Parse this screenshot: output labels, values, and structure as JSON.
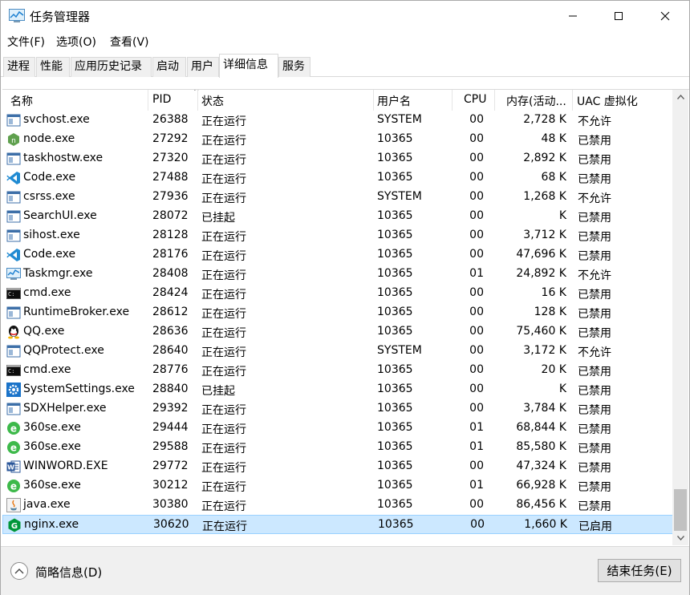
{
  "window": {
    "title": "任务管理器",
    "icon": "task-manager-icon"
  },
  "menu": [
    "文件(F)",
    "选项(O)",
    "查看(V)"
  ],
  "tabs": [
    "进程",
    "性能",
    "应用历史记录",
    "启动",
    "用户",
    "详细信息",
    "服务"
  ],
  "active_tab": "详细信息",
  "columns": {
    "name": "名称",
    "pid": "PID",
    "status": "状态",
    "user": "用户名",
    "cpu": "CPU",
    "mem": "内存(活动...",
    "uac": "UAC 虚拟化"
  },
  "rows": [
    {
      "icon": "svchost-icon",
      "name": "svchost.exe",
      "pid": "26388",
      "status": "正在运行",
      "user": "SYSTEM",
      "cpu": "00",
      "mem": "2,728 K",
      "uac": "不允许"
    },
    {
      "icon": "node-icon",
      "name": "node.exe",
      "pid": "27292",
      "status": "正在运行",
      "user": "10365",
      "cpu": "00",
      "mem": "48 K",
      "uac": "已禁用"
    },
    {
      "icon": "taskhostw-icon",
      "name": "taskhostw.exe",
      "pid": "27320",
      "status": "正在运行",
      "user": "10365",
      "cpu": "00",
      "mem": "2,892 K",
      "uac": "已禁用"
    },
    {
      "icon": "vscode-icon",
      "name": "Code.exe",
      "pid": "27488",
      "status": "正在运行",
      "user": "10365",
      "cpu": "00",
      "mem": "68 K",
      "uac": "已禁用"
    },
    {
      "icon": "csrss-icon",
      "name": "csrss.exe",
      "pid": "27936",
      "status": "正在运行",
      "user": "SYSTEM",
      "cpu": "00",
      "mem": "1,268 K",
      "uac": "不允许"
    },
    {
      "icon": "searchui-icon",
      "name": "SearchUI.exe",
      "pid": "28072",
      "status": "已挂起",
      "user": "10365",
      "cpu": "00",
      "mem": "K",
      "uac": "已禁用"
    },
    {
      "icon": "sihost-icon",
      "name": "sihost.exe",
      "pid": "28128",
      "status": "正在运行",
      "user": "10365",
      "cpu": "00",
      "mem": "3,712 K",
      "uac": "已禁用"
    },
    {
      "icon": "vscode-icon",
      "name": "Code.exe",
      "pid": "28176",
      "status": "正在运行",
      "user": "10365",
      "cpu": "00",
      "mem": "47,696 K",
      "uac": "已禁用"
    },
    {
      "icon": "taskmgr-icon",
      "name": "Taskmgr.exe",
      "pid": "28408",
      "status": "正在运行",
      "user": "10365",
      "cpu": "01",
      "mem": "24,892 K",
      "uac": "不允许"
    },
    {
      "icon": "cmd-icon",
      "name": "cmd.exe",
      "pid": "28424",
      "status": "正在运行",
      "user": "10365",
      "cpu": "00",
      "mem": "16 K",
      "uac": "已禁用"
    },
    {
      "icon": "runtimebroker-icon",
      "name": "RuntimeBroker.exe",
      "pid": "28612",
      "status": "正在运行",
      "user": "10365",
      "cpu": "00",
      "mem": "128 K",
      "uac": "已禁用"
    },
    {
      "icon": "qq-icon",
      "name": "QQ.exe",
      "pid": "28636",
      "status": "正在运行",
      "user": "10365",
      "cpu": "00",
      "mem": "75,460 K",
      "uac": "已禁用"
    },
    {
      "icon": "qqprotect-icon",
      "name": "QQProtect.exe",
      "pid": "28640",
      "status": "正在运行",
      "user": "SYSTEM",
      "cpu": "00",
      "mem": "3,172 K",
      "uac": "不允许"
    },
    {
      "icon": "cmd-icon",
      "name": "cmd.exe",
      "pid": "28776",
      "status": "正在运行",
      "user": "10365",
      "cpu": "00",
      "mem": "20 K",
      "uac": "已禁用"
    },
    {
      "icon": "settings-gear-icon",
      "name": "SystemSettings.exe",
      "pid": "28840",
      "status": "已挂起",
      "user": "10365",
      "cpu": "00",
      "mem": "K",
      "uac": "已禁用"
    },
    {
      "icon": "sdxhelper-icon",
      "name": "SDXHelper.exe",
      "pid": "29392",
      "status": "正在运行",
      "user": "10365",
      "cpu": "00",
      "mem": "3,784 K",
      "uac": "已禁用"
    },
    {
      "icon": "360se-icon",
      "name": "360se.exe",
      "pid": "29444",
      "status": "正在运行",
      "user": "10365",
      "cpu": "01",
      "mem": "68,844 K",
      "uac": "已禁用"
    },
    {
      "icon": "360se-icon",
      "name": "360se.exe",
      "pid": "29588",
      "status": "正在运行",
      "user": "10365",
      "cpu": "01",
      "mem": "85,580 K",
      "uac": "已禁用"
    },
    {
      "icon": "winword-icon",
      "name": "WINWORD.EXE",
      "pid": "29772",
      "status": "正在运行",
      "user": "10365",
      "cpu": "00",
      "mem": "47,324 K",
      "uac": "已禁用"
    },
    {
      "icon": "360se-icon",
      "name": "360se.exe",
      "pid": "30212",
      "status": "正在运行",
      "user": "10365",
      "cpu": "01",
      "mem": "66,928 K",
      "uac": "已禁用"
    },
    {
      "icon": "java-icon",
      "name": "java.exe",
      "pid": "30380",
      "status": "正在运行",
      "user": "10365",
      "cpu": "00",
      "mem": "86,456 K",
      "uac": "已禁用"
    },
    {
      "icon": "nginx-icon",
      "name": "nginx.exe",
      "pid": "30620",
      "status": "正在运行",
      "user": "10365",
      "cpu": "00",
      "mem": "1,660 K",
      "uac": "已启用",
      "selected": true
    }
  ],
  "footer": {
    "fewer_details": "简略信息(D)",
    "end_task": "结束任务(E)"
  },
  "colors": {
    "selected_bg": "#cce8ff",
    "selected_border": "#99d1ff"
  }
}
